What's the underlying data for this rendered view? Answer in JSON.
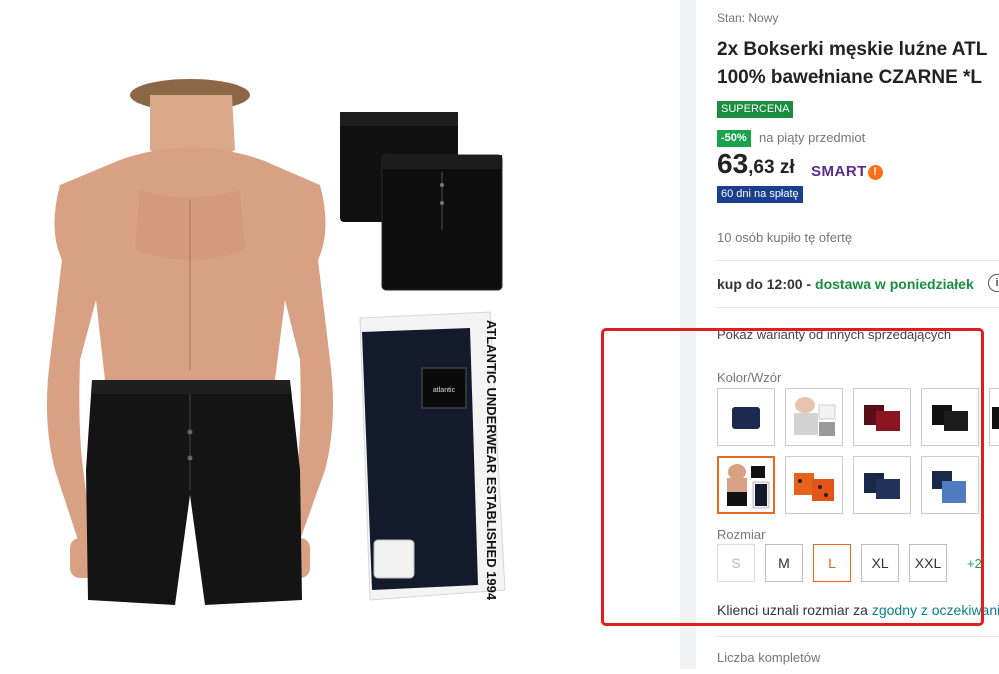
{
  "product": {
    "condition": "Stan: Nowy",
    "title_line1": "2x Bokserki męskie luźne ATL",
    "title_line2": "100% bawełniane CZARNE *L",
    "badge_supercena": "SUPERCENA",
    "discount_badge": "-50%",
    "discount_text": "na piąty przedmiot",
    "price_main": "63",
    "price_rest": ",63 zł",
    "smart_label": "SMART",
    "smart_mark": "!",
    "installments_badge": "60 dni na spłatę",
    "bought_count": "10 osób kupiło tę ofertę"
  },
  "delivery": {
    "prefix": "kup do 12:00 - ",
    "highlight": "dostawa w poniedziałek",
    "info_icon_glyph": "i"
  },
  "variants": {
    "other_sellers": "Pokaż warianty od innych sprzedających",
    "color_label": "Kolor/Wzór",
    "colors": [
      {
        "name": "navy"
      },
      {
        "name": "white-grey"
      },
      {
        "name": "maroon"
      },
      {
        "name": "black-pair"
      },
      {
        "name": "black-edge"
      },
      {
        "name": "selected-model-black"
      },
      {
        "name": "orange-pattern"
      },
      {
        "name": "navy-pair"
      },
      {
        "name": "navy-blue-mix"
      }
    ],
    "size_label": "Rozmiar",
    "sizes": [
      {
        "label": "S",
        "state": "disabled"
      },
      {
        "label": "M",
        "state": "normal"
      },
      {
        "label": "L",
        "state": "selected"
      },
      {
        "label": "XL",
        "state": "normal"
      },
      {
        "label": "XXL",
        "state": "normal"
      }
    ],
    "more_sizes": "+2",
    "fit_text": "Klienci uznali rozmiar za ",
    "fit_link": "zgodny z oczekiwaniami"
  },
  "quantity": {
    "label": "Liczba kompletów"
  },
  "gallery": {
    "package_brand": "ATLANTIC UNDERWEAR ESTABLISHED 1994",
    "package_logo": "atlantic"
  },
  "colors": {
    "accent_orange": "#e86a1a",
    "green": "#1a8d3e",
    "highlight_red": "#e01e1e",
    "navy_badge": "#1a3f8f"
  }
}
